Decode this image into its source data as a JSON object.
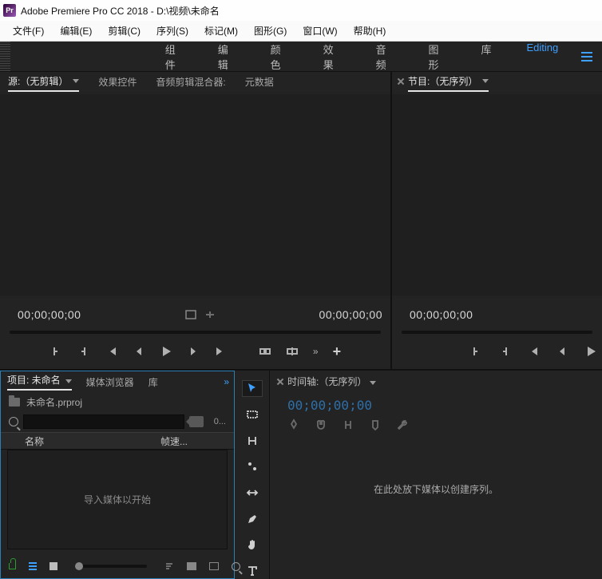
{
  "titlebar": {
    "app_icon_text": "Pr",
    "title": "Adobe Premiere Pro CC 2018 - D:\\视频\\未命名"
  },
  "menubar": {
    "items": [
      "文件(F)",
      "编辑(E)",
      "剪辑(C)",
      "序列(S)",
      "标记(M)",
      "图形(G)",
      "窗口(W)",
      "帮助(H)"
    ]
  },
  "workspaces": {
    "items": [
      "组件",
      "编辑",
      "颜色",
      "效果",
      "音频",
      "图形",
      "库",
      "Editing"
    ],
    "active_index": 7
  },
  "source_panel": {
    "tabs": [
      "源:（无剪辑）",
      "效果控件",
      "音频剪辑混合器:",
      "元数据"
    ],
    "active_tab": 0,
    "tc_left": "00;00;00;00",
    "tc_right": "00;00;00;00"
  },
  "program_panel": {
    "tab": "节目:（无序列）",
    "tc_left": "00;00;00;00"
  },
  "project_panel": {
    "tabs": [
      "项目: 未命名",
      "媒体浏览器",
      "库"
    ],
    "active_tab": 0,
    "project_file": "未命名.prproj",
    "item_count": "0...",
    "col_name": "名称",
    "col_fr": "帧速...",
    "empty_msg": "导入媒体以开始"
  },
  "timeline_panel": {
    "tab": "时间轴:（无序列）",
    "tc": "00;00;00;00",
    "empty_msg": "在此处放下媒体以创建序列。"
  }
}
